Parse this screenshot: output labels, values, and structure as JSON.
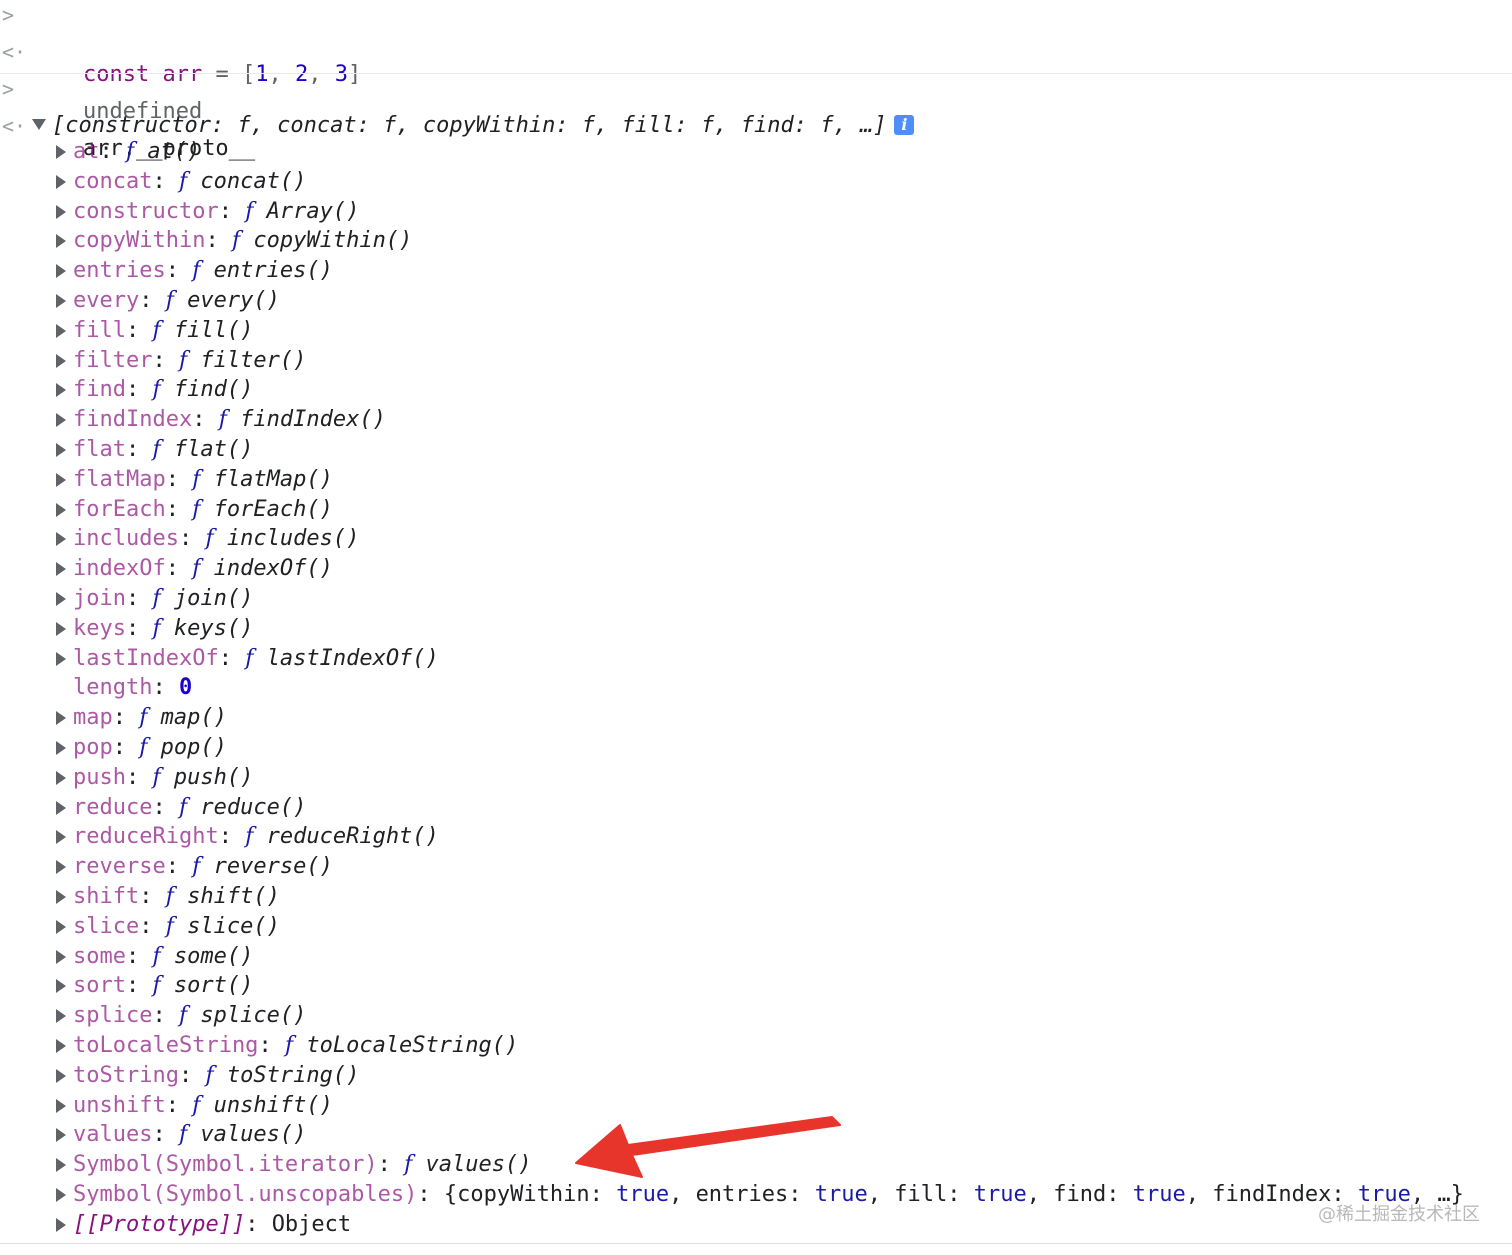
{
  "console": {
    "input1": {
      "kw": "const",
      "name": "arr",
      "op": " = ",
      "value_open": "[",
      "v1": "1",
      "v2": "2",
      "v3": "3",
      "value_close": "]",
      "sep": ", "
    },
    "output1": "undefined",
    "input2": "arr.__proto__",
    "summary": "[constructor: f, concat: f, copyWithin: f, fill: f, find: f, …]",
    "info_icon": "i",
    "properties": [
      {
        "key": "at",
        "f": "f",
        "value": "at()"
      },
      {
        "key": "concat",
        "f": "f",
        "value": "concat()"
      },
      {
        "key": "constructor",
        "f": "f",
        "value": "Array()"
      },
      {
        "key": "copyWithin",
        "f": "f",
        "value": "copyWithin()"
      },
      {
        "key": "entries",
        "f": "f",
        "value": "entries()"
      },
      {
        "key": "every",
        "f": "f",
        "value": "every()"
      },
      {
        "key": "fill",
        "f": "f",
        "value": "fill()"
      },
      {
        "key": "filter",
        "f": "f",
        "value": "filter()"
      },
      {
        "key": "find",
        "f": "f",
        "value": "find()"
      },
      {
        "key": "findIndex",
        "f": "f",
        "value": "findIndex()"
      },
      {
        "key": "flat",
        "f": "f",
        "value": "flat()"
      },
      {
        "key": "flatMap",
        "f": "f",
        "value": "flatMap()"
      },
      {
        "key": "forEach",
        "f": "f",
        "value": "forEach()"
      },
      {
        "key": "includes",
        "f": "f",
        "value": "includes()"
      },
      {
        "key": "indexOf",
        "f": "f",
        "value": "indexOf()"
      },
      {
        "key": "join",
        "f": "f",
        "value": "join()"
      },
      {
        "key": "keys",
        "f": "f",
        "value": "keys()"
      },
      {
        "key": "lastIndexOf",
        "f": "f",
        "value": "lastIndexOf()"
      },
      {
        "key": "length",
        "number": "0"
      },
      {
        "key": "map",
        "f": "f",
        "value": "map()"
      },
      {
        "key": "pop",
        "f": "f",
        "value": "pop()"
      },
      {
        "key": "push",
        "f": "f",
        "value": "push()"
      },
      {
        "key": "reduce",
        "f": "f",
        "value": "reduce()"
      },
      {
        "key": "reduceRight",
        "f": "f",
        "value": "reduceRight()"
      },
      {
        "key": "reverse",
        "f": "f",
        "value": "reverse()"
      },
      {
        "key": "shift",
        "f": "f",
        "value": "shift()"
      },
      {
        "key": "slice",
        "f": "f",
        "value": "slice()"
      },
      {
        "key": "some",
        "f": "f",
        "value": "some()"
      },
      {
        "key": "sort",
        "f": "f",
        "value": "sort()"
      },
      {
        "key": "splice",
        "f": "f",
        "value": "splice()"
      },
      {
        "key": "toLocaleString",
        "f": "f",
        "value": "toLocaleString()"
      },
      {
        "key": "toString",
        "f": "f",
        "value": "toString()"
      },
      {
        "key": "unshift",
        "f": "f",
        "value": "unshift()"
      },
      {
        "key": "values",
        "f": "f",
        "value": "values()"
      },
      {
        "key": "Symbol(Symbol.iterator)",
        "f": "f",
        "value": "values()"
      },
      {
        "key": "Symbol(Symbol.unscopables)",
        "unscopables": [
          {
            "k": "copyWithin",
            "v": "true"
          },
          {
            "k": "entries",
            "v": "true"
          },
          {
            "k": "fill",
            "v": "true"
          },
          {
            "k": "find",
            "v": "true"
          },
          {
            "k": "findIndex",
            "v": "true"
          }
        ],
        "open": "{",
        "more": "…}"
      },
      {
        "key": "[[Prototype]]",
        "plain": "Object"
      }
    ]
  },
  "watermark": "@稀土掘金技术社区",
  "colors": {
    "key": "#881280",
    "function_symbol": "#1a1aa6",
    "number": "#1c00cf",
    "annotation_arrow": "#e8352b"
  }
}
